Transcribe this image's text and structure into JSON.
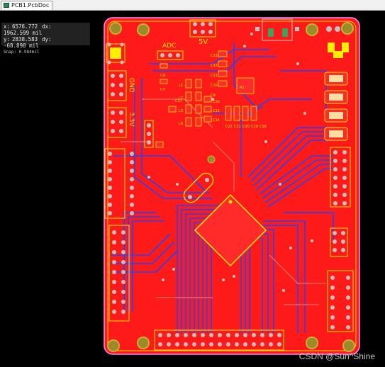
{
  "tab": {
    "title": "PCB1.PcbDoc",
    "icon": "pcb-document-icon"
  },
  "readout": {
    "x_label": "x:",
    "x_value": "6576.772",
    "dx_label": "dx:",
    "dx_value": "1962.599 mil",
    "y_label": "y:",
    "y_value": "2838.583",
    "dy_label": "dy:",
    "dy_value": "-68.898  mil",
    "snap": "Snap: 0.984mil"
  },
  "silkscreen": {
    "adc": "ADC",
    "v5": "5V",
    "gnd": "GND",
    "v33": "3.3V",
    "caps_left": [
      "C13",
      "C12",
      "C11",
      "C10",
      "C9"
    ],
    "caps_mid": [
      "C17",
      "C16",
      "C15",
      "C14"
    ],
    "caps_bottom": [
      "C22",
      "C21",
      "C20",
      "C19",
      "C18"
    ],
    "misc": [
      "C8",
      "C7",
      "L1",
      "L2",
      "L3",
      "L4",
      "R1"
    ]
  },
  "colors": {
    "board": "#ff1a1a",
    "trace_bottom": "#2244ff",
    "silk": "#ffee00",
    "pad": "#c0c0c0",
    "hole": "#9a8a2a"
  },
  "watermark": "CSDN @Sun^Shine"
}
